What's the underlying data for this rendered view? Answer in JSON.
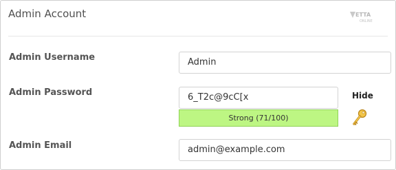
{
  "panel": {
    "title": "Admin Account",
    "logo_text": "VETTA ONLINE"
  },
  "fields": {
    "username": {
      "label": "Admin Username",
      "value": "Admin"
    },
    "password": {
      "label": "Admin Password",
      "value": "6_T2c@9cC[x",
      "strength_text": "Strong (71/100)",
      "strength_score": 71,
      "hide_label": "Hide",
      "generate_icon": "key-icon"
    },
    "email": {
      "label": "Admin Email",
      "value": "admin@example.com"
    }
  },
  "colors": {
    "strength_bg": "#bdf683",
    "key_icon": "#e0a82a"
  }
}
